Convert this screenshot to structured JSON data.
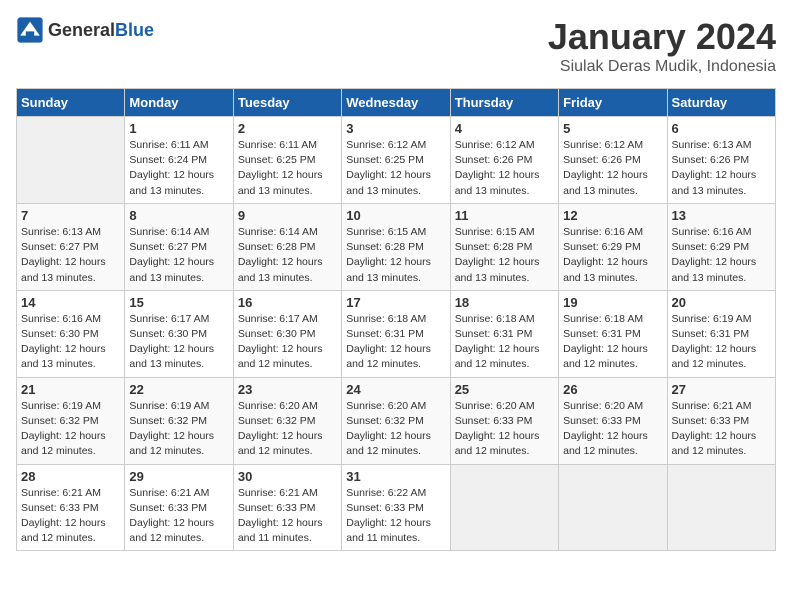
{
  "logo": {
    "general": "General",
    "blue": "Blue"
  },
  "title": "January 2024",
  "subtitle": "Siulak Deras Mudik, Indonesia",
  "weekdays": [
    "Sunday",
    "Monday",
    "Tuesday",
    "Wednesday",
    "Thursday",
    "Friday",
    "Saturday"
  ],
  "weeks": [
    [
      {
        "day": "",
        "info": ""
      },
      {
        "day": "1",
        "info": "Sunrise: 6:11 AM\nSunset: 6:24 PM\nDaylight: 12 hours\nand 13 minutes."
      },
      {
        "day": "2",
        "info": "Sunrise: 6:11 AM\nSunset: 6:25 PM\nDaylight: 12 hours\nand 13 minutes."
      },
      {
        "day": "3",
        "info": "Sunrise: 6:12 AM\nSunset: 6:25 PM\nDaylight: 12 hours\nand 13 minutes."
      },
      {
        "day": "4",
        "info": "Sunrise: 6:12 AM\nSunset: 6:26 PM\nDaylight: 12 hours\nand 13 minutes."
      },
      {
        "day": "5",
        "info": "Sunrise: 6:12 AM\nSunset: 6:26 PM\nDaylight: 12 hours\nand 13 minutes."
      },
      {
        "day": "6",
        "info": "Sunrise: 6:13 AM\nSunset: 6:26 PM\nDaylight: 12 hours\nand 13 minutes."
      }
    ],
    [
      {
        "day": "7",
        "info": "Sunrise: 6:13 AM\nSunset: 6:27 PM\nDaylight: 12 hours\nand 13 minutes."
      },
      {
        "day": "8",
        "info": "Sunrise: 6:14 AM\nSunset: 6:27 PM\nDaylight: 12 hours\nand 13 minutes."
      },
      {
        "day": "9",
        "info": "Sunrise: 6:14 AM\nSunset: 6:28 PM\nDaylight: 12 hours\nand 13 minutes."
      },
      {
        "day": "10",
        "info": "Sunrise: 6:15 AM\nSunset: 6:28 PM\nDaylight: 12 hours\nand 13 minutes."
      },
      {
        "day": "11",
        "info": "Sunrise: 6:15 AM\nSunset: 6:28 PM\nDaylight: 12 hours\nand 13 minutes."
      },
      {
        "day": "12",
        "info": "Sunrise: 6:16 AM\nSunset: 6:29 PM\nDaylight: 12 hours\nand 13 minutes."
      },
      {
        "day": "13",
        "info": "Sunrise: 6:16 AM\nSunset: 6:29 PM\nDaylight: 12 hours\nand 13 minutes."
      }
    ],
    [
      {
        "day": "14",
        "info": "Sunrise: 6:16 AM\nSunset: 6:30 PM\nDaylight: 12 hours\nand 13 minutes."
      },
      {
        "day": "15",
        "info": "Sunrise: 6:17 AM\nSunset: 6:30 PM\nDaylight: 12 hours\nand 13 minutes."
      },
      {
        "day": "16",
        "info": "Sunrise: 6:17 AM\nSunset: 6:30 PM\nDaylight: 12 hours\nand 12 minutes."
      },
      {
        "day": "17",
        "info": "Sunrise: 6:18 AM\nSunset: 6:31 PM\nDaylight: 12 hours\nand 12 minutes."
      },
      {
        "day": "18",
        "info": "Sunrise: 6:18 AM\nSunset: 6:31 PM\nDaylight: 12 hours\nand 12 minutes."
      },
      {
        "day": "19",
        "info": "Sunrise: 6:18 AM\nSunset: 6:31 PM\nDaylight: 12 hours\nand 12 minutes."
      },
      {
        "day": "20",
        "info": "Sunrise: 6:19 AM\nSunset: 6:31 PM\nDaylight: 12 hours\nand 12 minutes."
      }
    ],
    [
      {
        "day": "21",
        "info": "Sunrise: 6:19 AM\nSunset: 6:32 PM\nDaylight: 12 hours\nand 12 minutes."
      },
      {
        "day": "22",
        "info": "Sunrise: 6:19 AM\nSunset: 6:32 PM\nDaylight: 12 hours\nand 12 minutes."
      },
      {
        "day": "23",
        "info": "Sunrise: 6:20 AM\nSunset: 6:32 PM\nDaylight: 12 hours\nand 12 minutes."
      },
      {
        "day": "24",
        "info": "Sunrise: 6:20 AM\nSunset: 6:32 PM\nDaylight: 12 hours\nand 12 minutes."
      },
      {
        "day": "25",
        "info": "Sunrise: 6:20 AM\nSunset: 6:33 PM\nDaylight: 12 hours\nand 12 minutes."
      },
      {
        "day": "26",
        "info": "Sunrise: 6:20 AM\nSunset: 6:33 PM\nDaylight: 12 hours\nand 12 minutes."
      },
      {
        "day": "27",
        "info": "Sunrise: 6:21 AM\nSunset: 6:33 PM\nDaylight: 12 hours\nand 12 minutes."
      }
    ],
    [
      {
        "day": "28",
        "info": "Sunrise: 6:21 AM\nSunset: 6:33 PM\nDaylight: 12 hours\nand 12 minutes."
      },
      {
        "day": "29",
        "info": "Sunrise: 6:21 AM\nSunset: 6:33 PM\nDaylight: 12 hours\nand 12 minutes."
      },
      {
        "day": "30",
        "info": "Sunrise: 6:21 AM\nSunset: 6:33 PM\nDaylight: 12 hours\nand 11 minutes."
      },
      {
        "day": "31",
        "info": "Sunrise: 6:22 AM\nSunset: 6:33 PM\nDaylight: 12 hours\nand 11 minutes."
      },
      {
        "day": "",
        "info": ""
      },
      {
        "day": "",
        "info": ""
      },
      {
        "day": "",
        "info": ""
      }
    ]
  ]
}
